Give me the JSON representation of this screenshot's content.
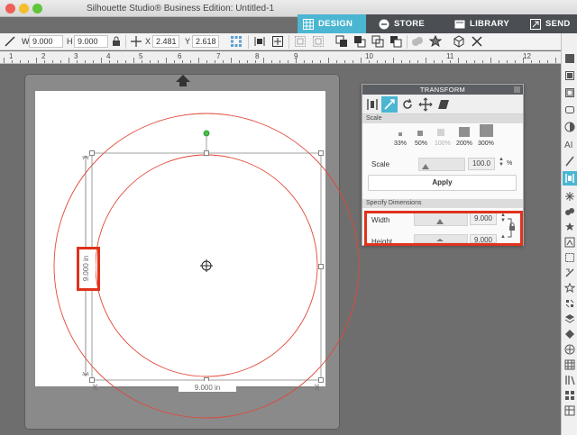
{
  "window": {
    "title": "Silhouette Studio® Business Edition: Untitled-1"
  },
  "nav": {
    "tabs": [
      {
        "label": "DESIGN",
        "active": true,
        "color": "#4bb6d1"
      },
      {
        "label": "STORE",
        "active": false,
        "color": "#4b4f54"
      },
      {
        "label": "LIBRARY",
        "active": false,
        "color": "#4b4f54"
      },
      {
        "label": "SEND",
        "active": false,
        "color": "#4b4f54"
      }
    ]
  },
  "toolbar": {
    "w_label": "W",
    "w_value": "9.000",
    "h_label": "H",
    "h_value": "9.000",
    "x_label": "X",
    "x_value": "2.481",
    "y_label": "Y",
    "y_value": "2.618"
  },
  "ruler": {
    "labels": [
      "1",
      "2",
      "3",
      "4",
      "5",
      "6",
      "7",
      "8",
      "9",
      "10",
      "11",
      "12"
    ]
  },
  "canvas": {
    "width_dimension": "9.000 in",
    "height_dimension": "9.000 in",
    "shape_color": "#e0483a",
    "rotate_handle_color": "#44c144"
  },
  "transform_panel": {
    "title": "TRANSFORM",
    "scale_section": "Scale",
    "percent_options": [
      "33%",
      "50%",
      "100%",
      "200%",
      "300%"
    ],
    "scale_label": "Scale",
    "scale_value": "100.0",
    "scale_unit": "%",
    "apply_label": "Apply",
    "dimensions_section": "Specify Dimensions",
    "width_label": "Width",
    "width_value": "9.000",
    "height_label": "Height",
    "height_value": "9.000",
    "highlight_color": "#e0321c"
  }
}
